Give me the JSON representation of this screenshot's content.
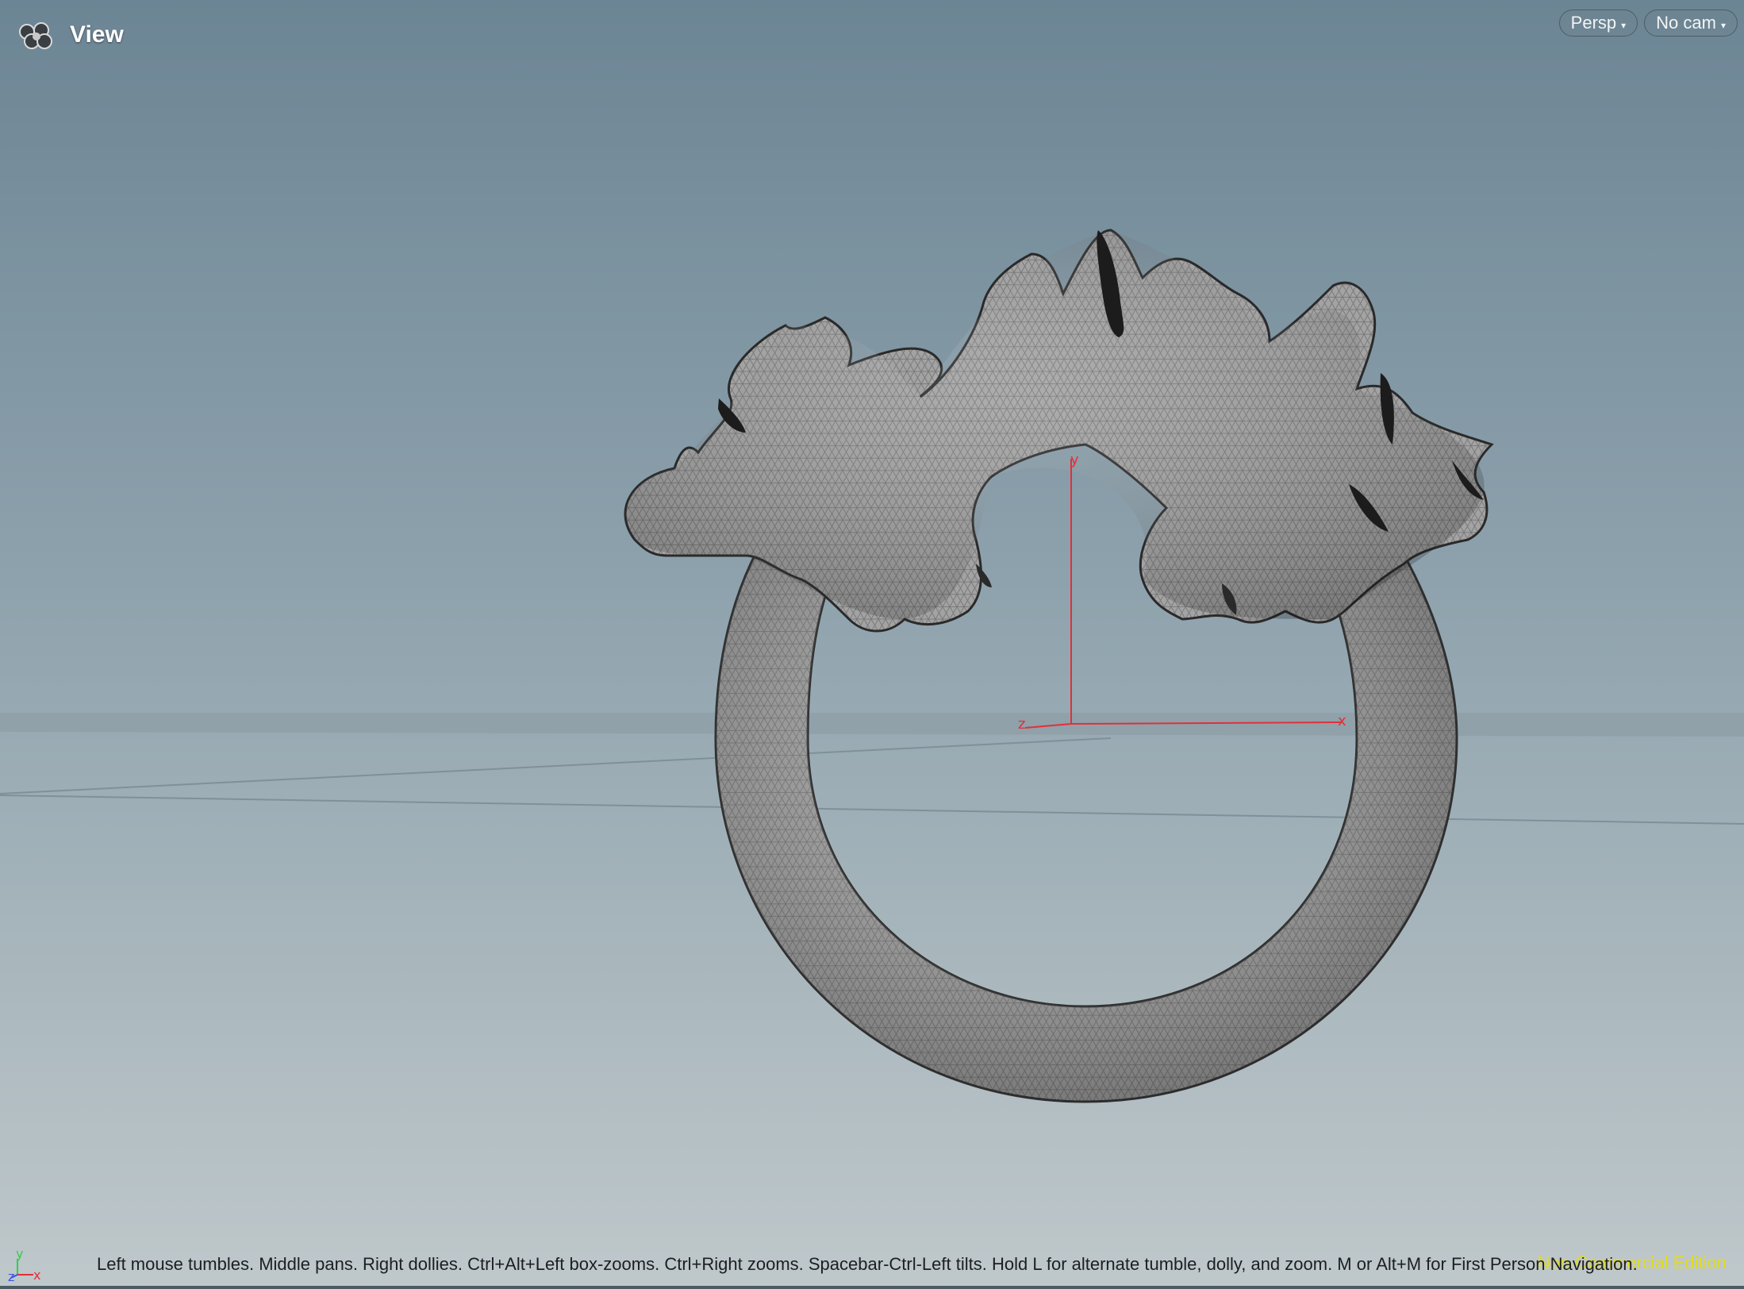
{
  "header": {
    "title": "View"
  },
  "camera": {
    "projection_label": "Persp",
    "camera_label": "No cam"
  },
  "axes": {
    "y_label": "y",
    "x_label": "x",
    "z_label": "z"
  },
  "mini_axes": {
    "y_label": "y",
    "x_label": "x",
    "z_label": "z"
  },
  "status": {
    "hint": "Left mouse tumbles. Middle pans. Right dollies. Ctrl+Alt+Left box-zooms. Ctrl+Right zooms. Spacebar-Ctrl-Left tilts. Hold L for alternate tumble, dolly, and zoom. M or Alt+M for First Person Navigation.",
    "edition": "Non-Commercial Edition"
  },
  "colors": {
    "axis_red": "#e0303a",
    "axis_green": "#2fd04a",
    "axis_blue": "#3b55e6",
    "mesh_fill": "#9b9b9b",
    "edition_yellow": "#e8e000"
  },
  "icons": {
    "app": "houdini-app-icon"
  }
}
